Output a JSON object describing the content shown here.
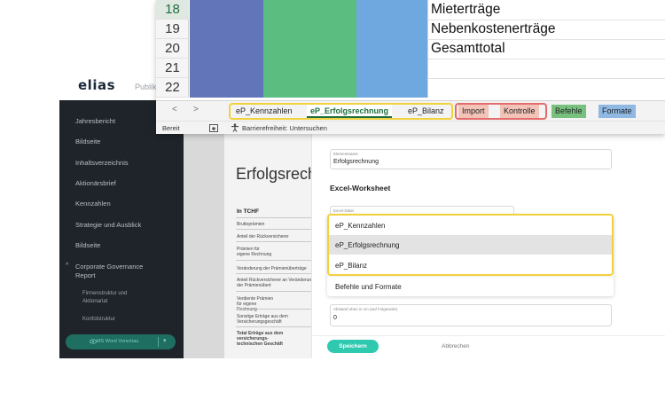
{
  "elias": {
    "logo": "elias",
    "topnav_label": "Publik",
    "sidebar": {
      "items": [
        "Jahresbericht",
        "Bildseite",
        "Inhaltsverzeichnis",
        "Aktionärsbrief",
        "Kennzahlen",
        "Strategie und Ausblick",
        "Bildseite",
        "Corporate Governance Report"
      ],
      "subitems": [
        "Firmenstruktur und Aktionariat",
        "Konfolstruktur"
      ],
      "pill_label": "MS Word Vorschau"
    },
    "document": {
      "title": "Erfolgsrech",
      "table_header": "In TCHF",
      "rows": [
        "Bruttoprämien",
        "Anteil der Rückversicherer",
        "Prämien für eigene Rechnung",
        "Veränderung der Prämienüberträge",
        "Anteil Rückversicherer an Veränderung der Prämienübert",
        "Verdiente Prämien für eigene Rechnung",
        "Sonstige Erträge aus dem Versicherungsgeschäft",
        "Total Erträge aus dem versicherungs-technischen Geschäft"
      ]
    }
  },
  "dialog": {
    "element_name_label": "Elementname",
    "element_name_value": "Erfolgsrechnung",
    "section_heading": "Excel-Worksheet",
    "excel_file_label": "Excel-Datei",
    "dropdown_options": [
      "eP_Kennzahlen",
      "eP_Erfolgsrechnung",
      "eP_Bilanz",
      "Befehle und Formate"
    ],
    "selected_option": "eP_Erfolgsrechnung",
    "spacing_label": "Abstand oben in cm (auf Folgeseite)",
    "spacing_value": "0",
    "save_label": "Speichern",
    "cancel_label": "Abbrechen"
  },
  "excel": {
    "row_numbers": [
      "18",
      "19",
      "20",
      "21",
      "22"
    ],
    "active_row": "18",
    "cells": [
      "Mieterträge",
      "Nebenkostenerträge",
      "Gesamttotal"
    ],
    "sheet_tabs": [
      "eP_Kennzahlen",
      "eP_Erfolgsrechnung",
      "eP_Bilanz",
      "Import",
      "Kontrolle",
      "Befehle",
      "Formate"
    ],
    "active_tab": "eP_Erfolgsrechnung",
    "status_ready": "Bereit",
    "status_accessibility": "Barrierefreiheit: Untersuchen",
    "colors": {
      "col_purple": "#6375b9",
      "col_green": "#5bbd7f",
      "col_blue": "#6ea8de",
      "highlight_yellow": "#f2d23c",
      "highlight_red": "#e36b6b",
      "accent_teal": "#2fc9b0"
    }
  }
}
